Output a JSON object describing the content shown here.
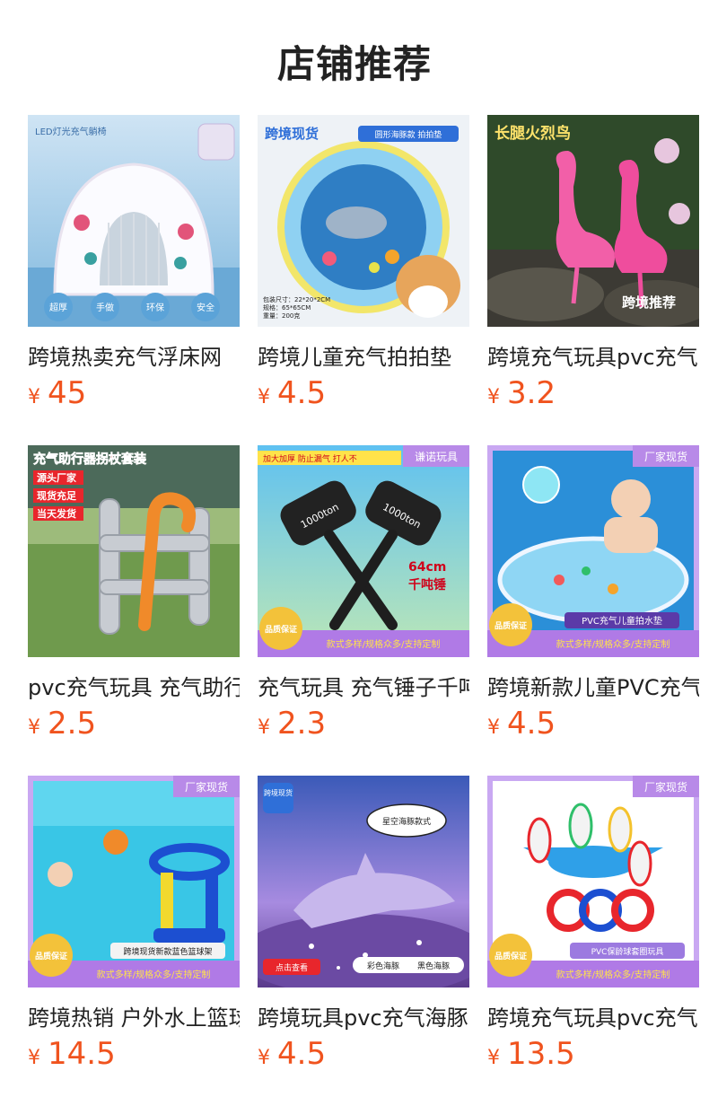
{
  "header": {
    "title": "店铺推荐"
  },
  "currency_symbol": "¥",
  "products": [
    {
      "name": "跨境热卖充气浮床网",
      "price": "45",
      "image_text": [
        "LED灯光充气躺椅",
        "超厚",
        "手做",
        "环保",
        "安全"
      ]
    },
    {
      "name": "跨境儿童充气拍拍垫",
      "price": "4.5",
      "image_text": [
        "跨境现货",
        "圆形海豚款 拍拍垫",
        "包装尺寸：22*20*2CM",
        "规格：65*65CM",
        "重量：200克"
      ]
    },
    {
      "name": "跨境充气玩具pvc充气",
      "price": "3.2",
      "image_text": [
        "长腿火烈鸟",
        "跨境推荐"
      ]
    },
    {
      "name": "pvc充气玩具 充气助行",
      "price": "2.5",
      "image_text": [
        "充气助行器拐杖套装",
        "源头厂家",
        "现货充足",
        "当天发货"
      ]
    },
    {
      "name": "充气玩具 充气锤子千吨",
      "price": "2.3",
      "image_text": [
        "加大加厚 防止漏气 打人不",
        "谦诺玩具",
        "1000ton",
        "64cm",
        "千吨锤",
        "品质保证",
        "款式多样/规格众多/支持定制"
      ]
    },
    {
      "name": "跨境新款儿童PVC充气",
      "price": "4.5",
      "image_text": [
        "厂家现货",
        "品质保证",
        "PVC充气儿童拍水垫",
        "款式多样/规格众多/支持定制"
      ]
    },
    {
      "name": "跨境热销 户外水上篮球",
      "price": "14.5",
      "image_text": [
        "厂家现货",
        "品质保证",
        "跨境现货新款蓝色篮球架",
        "款式多样/规格众多/支持定制"
      ]
    },
    {
      "name": "跨境玩具pvc充气海豚",
      "price": "4.5",
      "image_text": [
        "跨境现货",
        "星空海豚款式",
        "点击查看",
        "彩色海豚",
        "黑色海豚"
      ]
    },
    {
      "name": "跨境充气玩具pvc充气",
      "price": "13.5",
      "image_text": [
        "厂家现货",
        "品质保证",
        "PVC保龄球套圈玩具",
        "款式多样/规格众多/支持定制"
      ]
    }
  ],
  "colors": {
    "price": "#f0531e",
    "title": "#222222",
    "banner_purple": "#b07ae6"
  }
}
